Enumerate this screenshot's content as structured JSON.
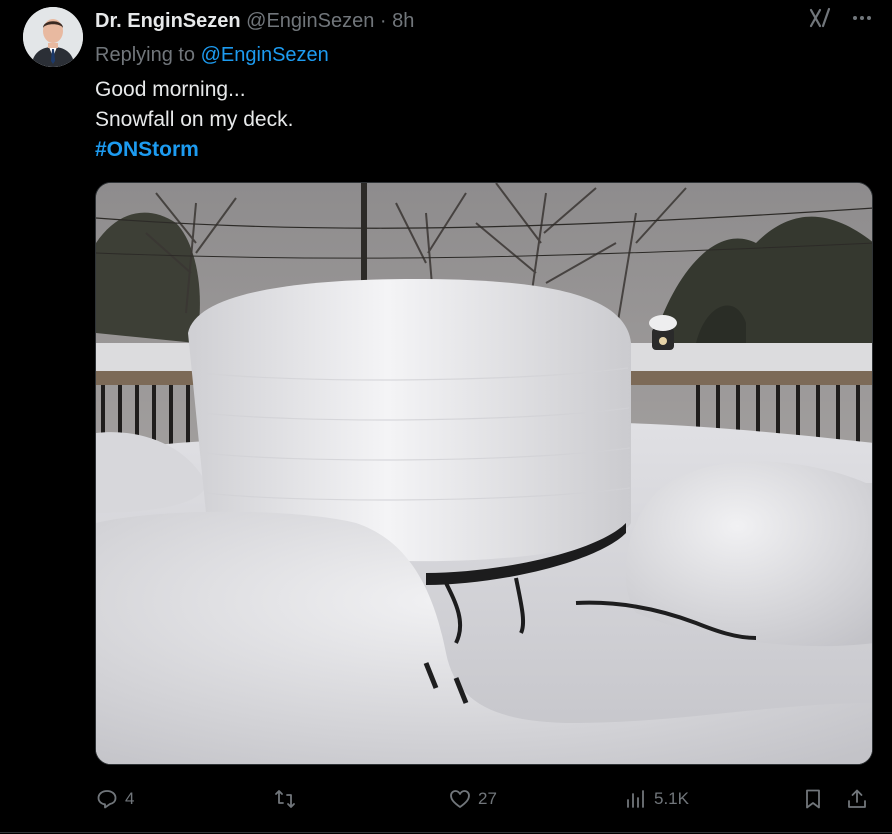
{
  "tweet": {
    "display_name": "Dr. EnginSezen",
    "handle": "@EnginSezen",
    "separator": "·",
    "timestamp": "8h",
    "replying_prefix": "Replying to",
    "replying_to": "@EnginSezen",
    "text_lines": [
      "Good morning...",
      "Snowfall on my deck."
    ],
    "hashtag": "#ONStorm",
    "media_alt_icon": "photo-of-snow-covered-deck"
  },
  "actions": {
    "reply_count": "4",
    "repost_count": "",
    "like_count": "27",
    "views_count": "5.1K"
  },
  "icons": {
    "grok": "grok-icon",
    "more": "more-icon",
    "reply": "reply-icon",
    "repost": "repost-icon",
    "like": "like-icon",
    "views": "views-icon",
    "bookmark": "bookmark-icon",
    "share": "share-icon"
  },
  "colors": {
    "background": "#000000",
    "text": "#e7e9ea",
    "muted": "#71767b",
    "accent": "#1d9bf0"
  }
}
